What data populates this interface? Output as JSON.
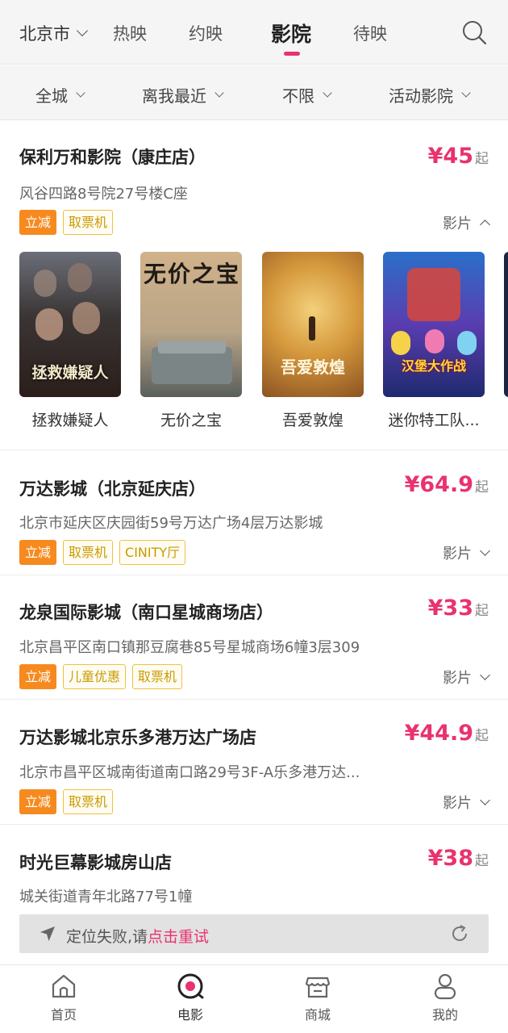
{
  "header": {
    "city": "北京市",
    "tabs": [
      {
        "label": "热映"
      },
      {
        "label": "约映"
      },
      {
        "label": "影院"
      },
      {
        "label": "待映"
      }
    ]
  },
  "filters": [
    "全城",
    "离我最近",
    "不限",
    "活动影院"
  ],
  "cinemas": [
    {
      "name": "保利万和影院（康庄店）",
      "price": "¥45",
      "price_suffix": "起",
      "address": "风谷四路8号院27号楼C座",
      "tags": [
        "立减",
        "取票机"
      ],
      "films_label": "影片",
      "expanded": true,
      "films": [
        "拯救嫌疑人",
        "无价之宝",
        "吾爱敦煌",
        "迷你特工队..."
      ],
      "poster_texts": [
        "拯救嫌疑人",
        "无价之宝",
        "吾爱敦煌",
        "汉堡大作战"
      ]
    },
    {
      "name": "万达影城（北京延庆店）",
      "price": "¥64.9",
      "price_suffix": "起",
      "address": "北京市延庆区庆园街59号万达广场4层万达影城",
      "tags": [
        "立减",
        "取票机",
        "CINITY厅"
      ],
      "films_label": "影片"
    },
    {
      "name": "龙泉国际影城（南口星城商场店）",
      "price": "¥33",
      "price_suffix": "起",
      "address": "北京昌平区南口镇那豆腐巷85号星城商场6幢3层309",
      "tags": [
        "立减",
        "儿童优惠",
        "取票机"
      ],
      "films_label": "影片"
    },
    {
      "name": "万达影城北京乐多港万达广场店",
      "price": "¥44.9",
      "price_suffix": "起",
      "address": "北京市昌平区城南街道南口路29号3F-A乐多港万达...",
      "tags": [
        "立减",
        "取票机"
      ],
      "films_label": "影片"
    },
    {
      "name": "时光巨幕影城房山店",
      "price": "¥38",
      "price_suffix": "起",
      "address": "城关街道青年北路77号1幢"
    }
  ],
  "locate_bar": {
    "text": "定位失败,请",
    "retry": "点击重试"
  },
  "bottom_nav": [
    {
      "label": "首页"
    },
    {
      "label": "电影"
    },
    {
      "label": "商城"
    },
    {
      "label": "我的"
    }
  ],
  "colors": {
    "accent": "#e8336e",
    "tag_solid": "#f68a1e",
    "tag_outline": "#f0c040"
  }
}
